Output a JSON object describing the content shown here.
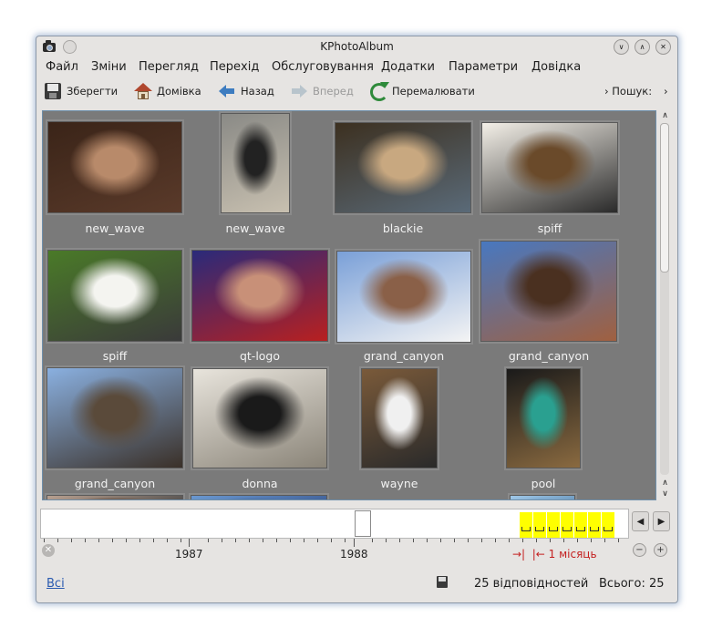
{
  "window": {
    "title": "KPhotoAlbum"
  },
  "menubar": {
    "items": [
      {
        "id": "file",
        "label": "Файл"
      },
      {
        "id": "edit",
        "label": "Зміни"
      },
      {
        "id": "view",
        "label": "Перегляд"
      },
      {
        "id": "go",
        "label": "Перехід"
      },
      {
        "id": "maintenance",
        "label": "Обслуговування"
      },
      {
        "id": "plugins",
        "label": "Додатки"
      },
      {
        "id": "settings",
        "label": "Параметри"
      },
      {
        "id": "help",
        "label": "Довідка"
      }
    ]
  },
  "toolbar": {
    "save_label": "Зберегти",
    "home_label": "Домівка",
    "back_label": "Назад",
    "forward_label": "Вперед",
    "redraw_label": "Перемалювати",
    "search_label": "Пошук:"
  },
  "thumbnails": [
    {
      "label": "new_wave",
      "colors": [
        "#3a2418",
        "#b88a6a",
        "#5a3a2a"
      ]
    },
    {
      "label": "new_wave",
      "colors": [
        "#8a8a86",
        "#222222",
        "#c8c0b0"
      ]
    },
    {
      "label": "blackie",
      "colors": [
        "#3c3020",
        "#c8a880",
        "#5a6a78"
      ]
    },
    {
      "label": "spiff",
      "colors": [
        "#f4f0e8",
        "#6a4a2a",
        "#2a2a2a"
      ]
    },
    {
      "label": "spiff",
      "colors": [
        "#4a7a28",
        "#f4f4f0",
        "#3a3a3a"
      ]
    },
    {
      "label": "qt-logo",
      "colors": [
        "#2a2a7a",
        "#c89078",
        "#b82020"
      ]
    },
    {
      "label": "grand_canyon",
      "colors": [
        "#7aa0d8",
        "#8a6048",
        "#f4f4f4"
      ]
    },
    {
      "label": "grand_canyon",
      "colors": [
        "#4878c0",
        "#4a3020",
        "#a06040"
      ]
    },
    {
      "label": "grand_canyon",
      "colors": [
        "#8ab0e0",
        "#5a4a3a",
        "#3a3028"
      ]
    },
    {
      "label": "donna",
      "colors": [
        "#e8e4dc",
        "#1a1a1a",
        "#8a8478"
      ]
    },
    {
      "label": "wayne",
      "colors": [
        "#7a5a3a",
        "#f0f0f0",
        "#2a2a2a"
      ]
    },
    {
      "label": "pool",
      "colors": [
        "#1a1a1a",
        "#2aa090",
        "#8a6a40"
      ]
    },
    {
      "label": "",
      "colors": [
        "#b8a090",
        "#6a5040",
        "#444444"
      ]
    },
    {
      "label": "",
      "colors": [
        "#6a98d0",
        "#4a70a8",
        "#3a5890"
      ]
    },
    {
      "label": "",
      "colors": [
        "#a0c8e8",
        "#7aa8d0",
        "#5a88b0"
      ]
    }
  ],
  "timeline": {
    "year_labels": [
      "1987",
      "1988"
    ],
    "unit_label": "1 місяць",
    "bar_color": "#ffff00"
  },
  "statusbar": {
    "all_link": "Всі",
    "matches": "25 відповідностей",
    "total": "Всього: 25"
  }
}
